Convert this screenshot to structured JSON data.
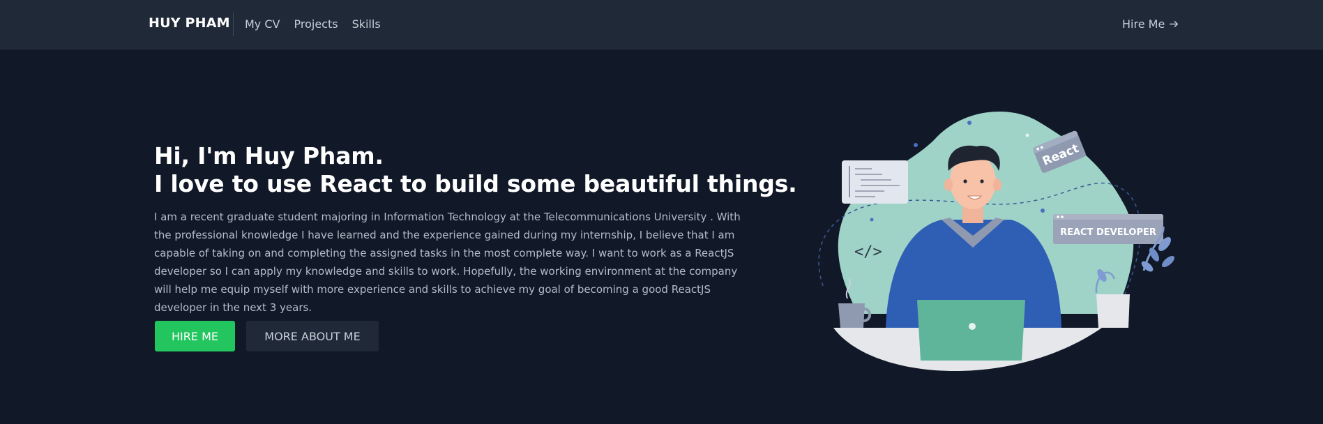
{
  "nav": {
    "brand": "HUY PHAM",
    "links": [
      "My CV",
      "Projects",
      "Skills"
    ],
    "hire": "Hire Me"
  },
  "hero": {
    "title_line1": "Hi, I'm Huy Pham.",
    "title_line2": "I love to use React to build some beautiful things.",
    "description": "I am a recent graduate student majoring in Information Technology at the Telecommunications University . With the professional knowledge I have learned and the experience gained during my internship, I believe that I am capable of taking on and completing the assigned tasks in the most complete way. I want to work as a ReactJS developer so I can apply my knowledge and skills to work. Hopefully, the working environment at the company will help me equip myself with more experience and skills to achieve my goal of becoming a good ReactJS developer in the next 3 years.",
    "btn_hire": "HIRE ME",
    "btn_more": "MORE ABOUT ME"
  },
  "illustration": {
    "react_tag": "React",
    "role_tag": "REACT DEVELOPER",
    "code_tag": "</>"
  },
  "colors": {
    "background": "#111827",
    "navbar": "#1f2937",
    "accent_green": "#22c55e",
    "blob": "#9fd3c7"
  }
}
